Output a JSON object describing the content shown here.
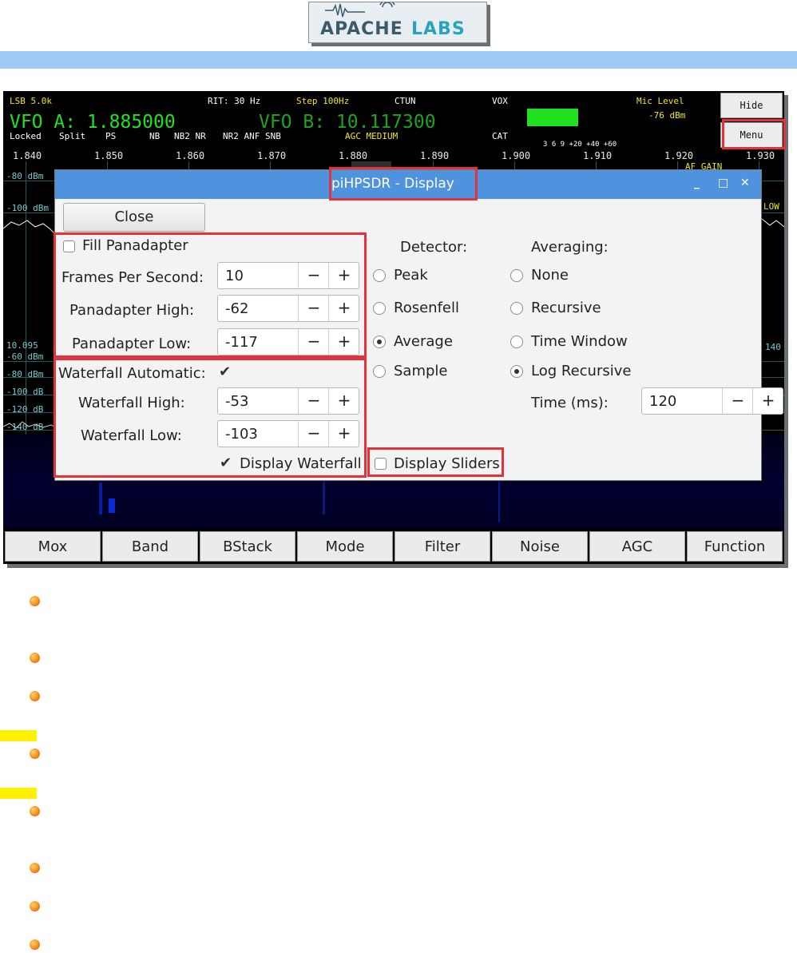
{
  "logo": {
    "text": "APACHE LABS"
  },
  "radio": {
    "status": {
      "mode_filter": "LSB 5.0k",
      "rit": "RIT: 30 Hz",
      "step": "Step 100Hz",
      "ctun": "CTUN",
      "vox": "VOX",
      "mic_level": "Mic Level",
      "mic_db": "-76 dBm",
      "locked": "Locked",
      "split": "Split",
      "ps": "PS",
      "nb": "NB",
      "nb2_nr": "NB2 NR",
      "nr2_anf_snb": "NR2 ANF SNB",
      "agc": "AGC MEDIUM",
      "cat": "CAT",
      "af_gain": "AF GAIN",
      "low": "LOW"
    },
    "vfo_a": "VFO A: 1.885000",
    "vfo_b": "VFO B: 10.117300",
    "freq_ticks": [
      "1.840",
      "1.850",
      "1.860",
      "1.870",
      "1.880",
      "1.890",
      "1.900",
      "1.910",
      "1.920",
      "1.930"
    ],
    "db_labels": [
      "-80 dBm",
      "-100 dBm",
      "-60 dBm",
      "-80 dBm",
      "-100 dB",
      "-120 dB",
      "-140 dB"
    ],
    "wf_freq": "10.095",
    "wf_right": "140",
    "meter_scale": "3  6  9 +20 +40 +60",
    "side_buttons": {
      "hide": "Hide",
      "menu": "Menu"
    },
    "bottom_buttons": [
      "Mox",
      "Band",
      "BStack",
      "Mode",
      "Filter",
      "Noise",
      "AGC",
      "Function"
    ]
  },
  "dialog": {
    "title": "piHPSDR - Display",
    "close": "Close",
    "fill_panadapter": {
      "label": "Fill Panadapter",
      "checked": false
    },
    "fps": {
      "label": "Frames Per Second:",
      "value": "10"
    },
    "pan_high": {
      "label": "Panadapter High:",
      "value": "-62"
    },
    "pan_low": {
      "label": "Panadapter Low:",
      "value": "-117"
    },
    "wf_auto": {
      "label": "Waterfall Automatic:",
      "checked": true
    },
    "wf_high": {
      "label": "Waterfall High:",
      "value": "-53"
    },
    "wf_low": {
      "label": "Waterfall Low:",
      "value": "-103"
    },
    "display_waterfall": {
      "label": "Display Waterfall",
      "checked": true
    },
    "display_sliders": {
      "label": "Display Sliders",
      "checked": false
    },
    "detector": {
      "heading": "Detector:",
      "options": [
        "Peak",
        "Rosenfell",
        "Average",
        "Sample"
      ],
      "selected": "Average"
    },
    "averaging": {
      "heading": "Averaging:",
      "options": [
        "None",
        "Recursive",
        "Time Window",
        "Log Recursive"
      ],
      "selected": "Log Recursive"
    },
    "time_ms": {
      "label": "Time (ms):",
      "value": "120"
    },
    "spin_minus": "−",
    "spin_plus": "+",
    "check_mark": "✔",
    "win_min": "_",
    "win_max": "□",
    "win_close": "✕"
  }
}
